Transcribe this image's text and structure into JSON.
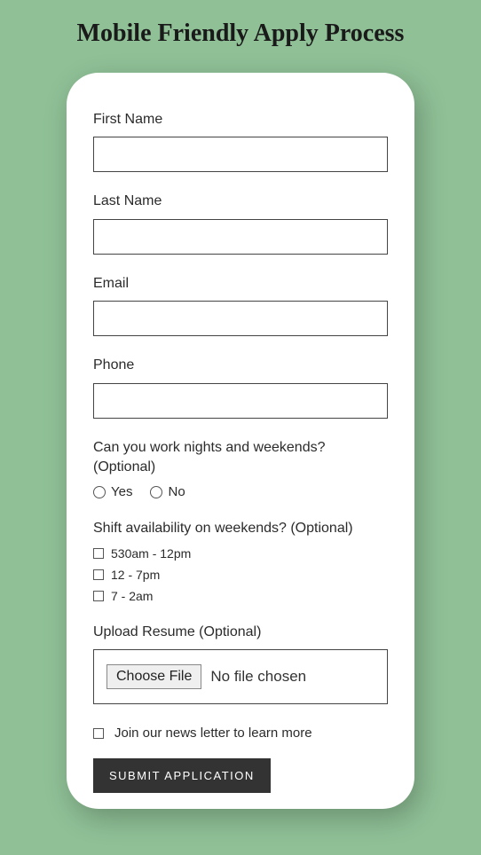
{
  "pageTitle": "Mobile Friendly Apply Process",
  "fields": {
    "firstName": {
      "label": "First Name",
      "value": ""
    },
    "lastName": {
      "label": "Last Name",
      "value": ""
    },
    "email": {
      "label": "Email",
      "value": ""
    },
    "phone": {
      "label": "Phone",
      "value": ""
    }
  },
  "nightsWeekends": {
    "label": "Can you work nights and weekends? (Optional)",
    "options": {
      "yes": "Yes",
      "no": "No"
    }
  },
  "shiftAvailability": {
    "label": "Shift availability on weekends? (Optional)",
    "options": {
      "slot1": "530am - 12pm",
      "slot2": "12 - 7pm",
      "slot3": "7 - 2am"
    }
  },
  "uploadResume": {
    "label": "Upload Resume (Optional)",
    "buttonText": "Choose File",
    "statusText": "No file chosen"
  },
  "newsletter": {
    "label": "Join our news letter to learn more"
  },
  "submit": {
    "label": "SUBMIT APPLICATION"
  }
}
